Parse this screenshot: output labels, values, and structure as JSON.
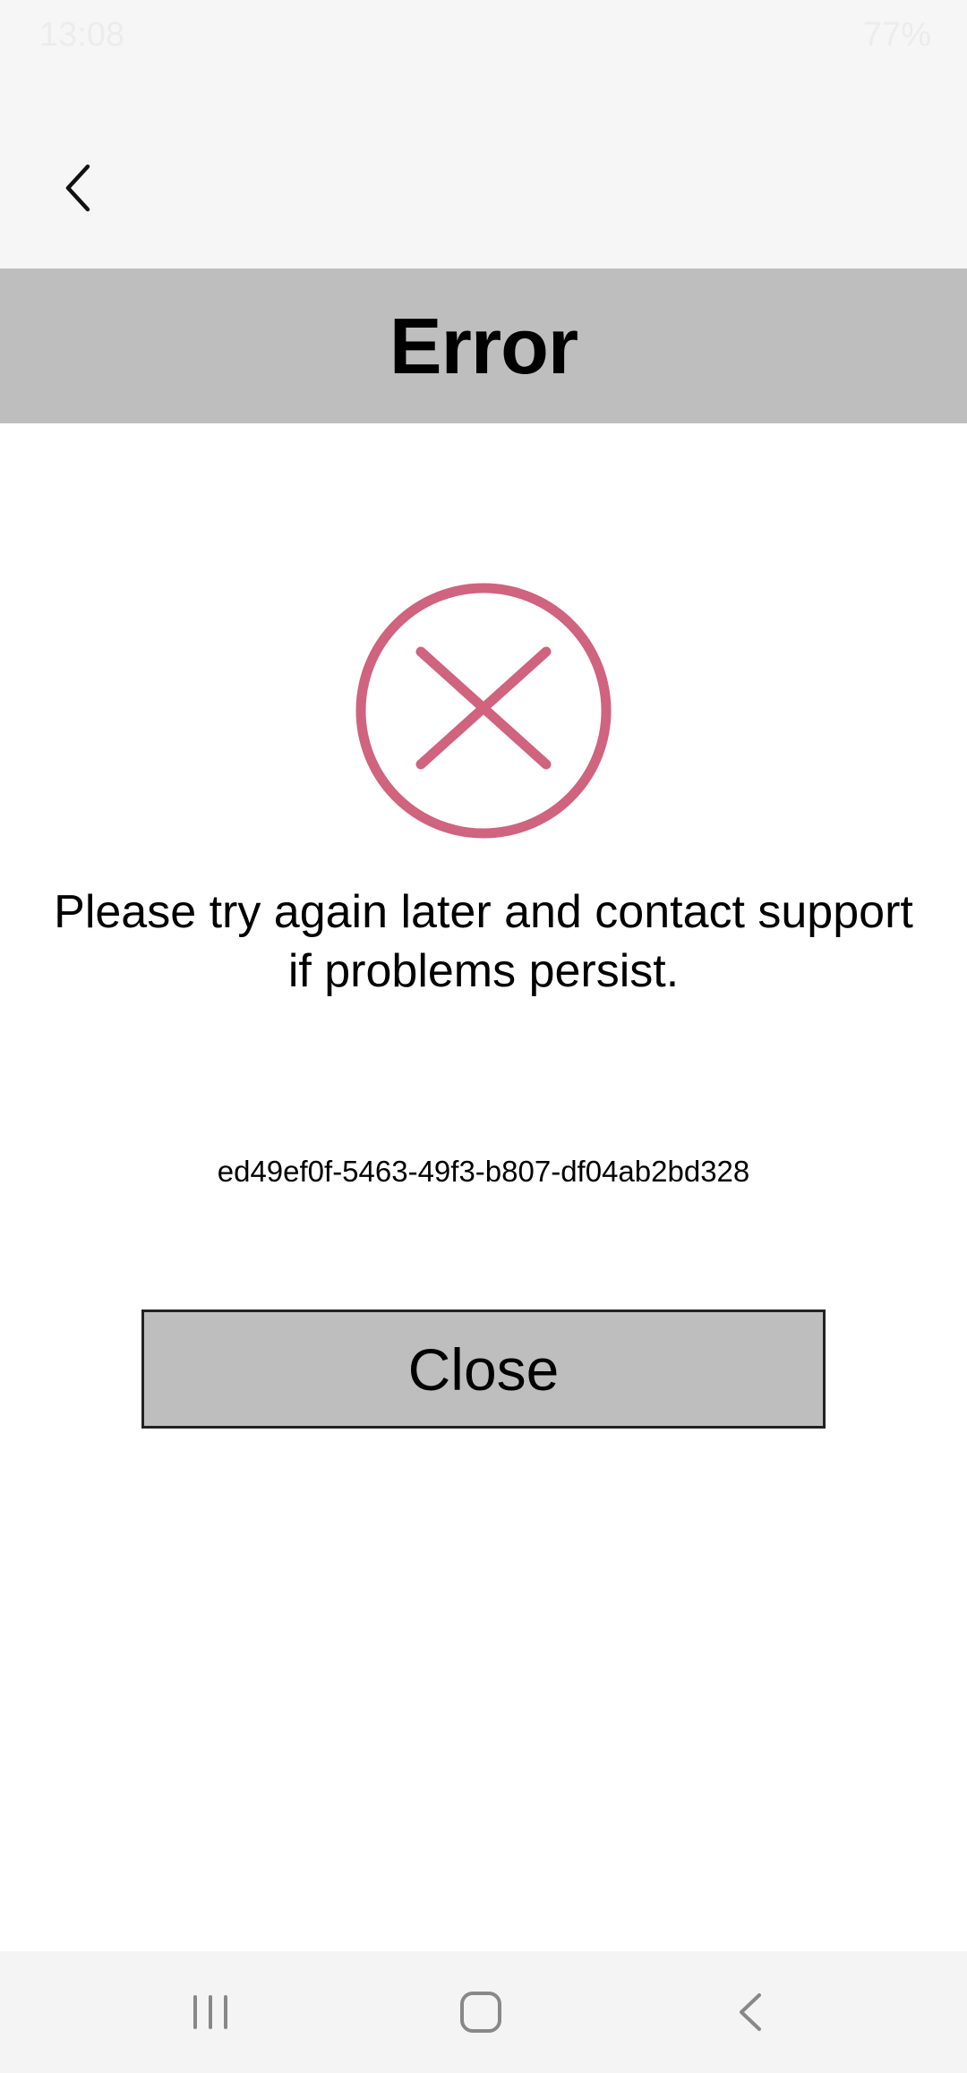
{
  "status_bar": {
    "time": "13:08",
    "battery": "77%"
  },
  "header": {
    "title": "Error"
  },
  "error": {
    "icon": "close-circle-icon",
    "color": "#d0637e",
    "message": "Please try again later and contact support if problems persist.",
    "id": "ed49ef0f-5463-49f3-b807-df04ab2bd328"
  },
  "actions": {
    "close_label": "Close"
  },
  "nav": {
    "recents": "recents-icon",
    "home": "home-icon",
    "back": "back-icon"
  },
  "colors": {
    "title_bar": "#bebebe",
    "app_bar": "#f6f6f6",
    "button_bg": "#bebebe"
  }
}
